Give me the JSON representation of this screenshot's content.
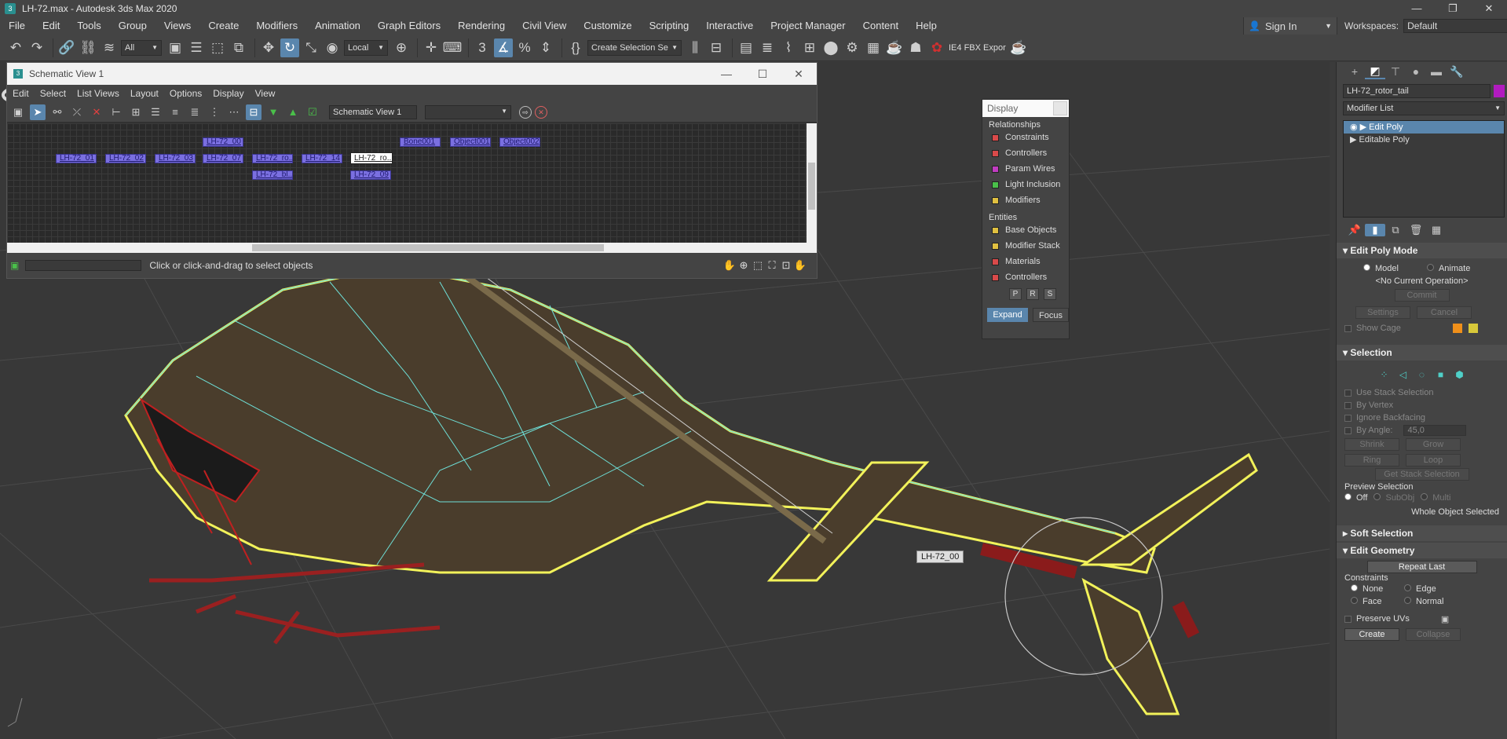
{
  "window": {
    "title": "LH-72.max - Autodesk 3ds Max 2020",
    "minimize": "—",
    "restore": "❐",
    "close": "✕"
  },
  "menu": [
    "File",
    "Edit",
    "Tools",
    "Group",
    "Views",
    "Create",
    "Modifiers",
    "Animation",
    "Graph Editors",
    "Rendering",
    "Civil View",
    "Customize",
    "Scripting",
    "Interactive",
    "Project Manager",
    "Content",
    "Help"
  ],
  "account": {
    "signin": "Sign In",
    "workspaces_label": "Workspaces:",
    "workspace": "Default"
  },
  "toolbar": {
    "filter": "All",
    "coord": "Local",
    "named_selection": "Create Selection Se",
    "fbx": "IE4 FBX Expor"
  },
  "schematic": {
    "title": "Schematic View 1",
    "menu": [
      "Edit",
      "Select",
      "List Views",
      "Layout",
      "Options",
      "Display",
      "View"
    ],
    "name_field": "Schematic View 1",
    "status": "Click or click-and-drag to select objects",
    "nodes": [
      {
        "label": "LH-72_00"
      },
      {
        "label": "Bone001"
      },
      {
        "label": "Object001"
      },
      {
        "label": "Object002"
      },
      {
        "label": "LH-72_01"
      },
      {
        "label": "LH-72_02"
      },
      {
        "label": "LH-72_03"
      },
      {
        "label": "LH-72_07"
      },
      {
        "label": "LH-72_ro..."
      },
      {
        "label": "LH-72_14"
      },
      {
        "label": "LH-72_ro...",
        "selected": true
      },
      {
        "label": "LH-72_bl..."
      },
      {
        "label": "LH-72_09"
      }
    ]
  },
  "display": {
    "title": "Display",
    "relationships_label": "Relationships",
    "relationships": [
      {
        "label": "Constraints",
        "color": "#d94a4a"
      },
      {
        "label": "Controllers",
        "color": "#d94a4a"
      },
      {
        "label": "Param Wires",
        "color": "#c03cc0"
      },
      {
        "label": "Light Inclusion",
        "color": "#4ac04a"
      },
      {
        "label": "Modifiers",
        "color": "#e0c040"
      }
    ],
    "entities_label": "Entities",
    "entities": [
      {
        "label": "Base Objects",
        "color": "#e0c040"
      },
      {
        "label": "Modifier Stack",
        "color": "#e0c040"
      },
      {
        "label": "Materials",
        "color": "#d94a4a"
      },
      {
        "label": "Controllers",
        "color": "#d94a4a"
      }
    ],
    "prs": [
      "P",
      "R",
      "S"
    ],
    "expand": "Expand",
    "focus": "Focus"
  },
  "viewport": {
    "object_label": "LH-72_00"
  },
  "command_panel": {
    "object_name": "LH-72_rotor_tail",
    "object_color": "#b21bc0",
    "modifier_list": "Modifier List",
    "stack": [
      {
        "label": "Edit Poly",
        "selected": true
      },
      {
        "label": "Editable Poly",
        "selected": false
      }
    ],
    "edit_poly_mode": {
      "title": "Edit Poly Mode",
      "model": "Model",
      "animate": "Animate",
      "operation": "<No Current Operation>",
      "commit": "Commit",
      "settings": "Settings",
      "cancel": "Cancel",
      "show_cage": "Show Cage"
    },
    "selection": {
      "title": "Selection",
      "use_stack": "Use Stack Selection",
      "by_vertex": "By Vertex",
      "ignore_backfacing": "Ignore Backfacing",
      "by_angle": "By Angle:",
      "angle_value": "45,0",
      "shrink": "Shrink",
      "grow": "Grow",
      "ring": "Ring",
      "loop": "Loop",
      "get_stack": "Get Stack Selection",
      "preview_label": "Preview Selection",
      "preview_off": "Off",
      "preview_subobj": "SubObj",
      "preview_multi": "Multi",
      "status": "Whole Object Selected"
    },
    "soft_selection": {
      "title": "Soft Selection"
    },
    "edit_geometry": {
      "title": "Edit Geometry",
      "repeat_last": "Repeat Last",
      "constraints_label": "Constraints",
      "none": "None",
      "edge": "Edge",
      "face": "Face",
      "normal": "Normal",
      "preserve_uvs": "Preserve UVs",
      "create": "Create",
      "collapse": "Collapse"
    }
  }
}
